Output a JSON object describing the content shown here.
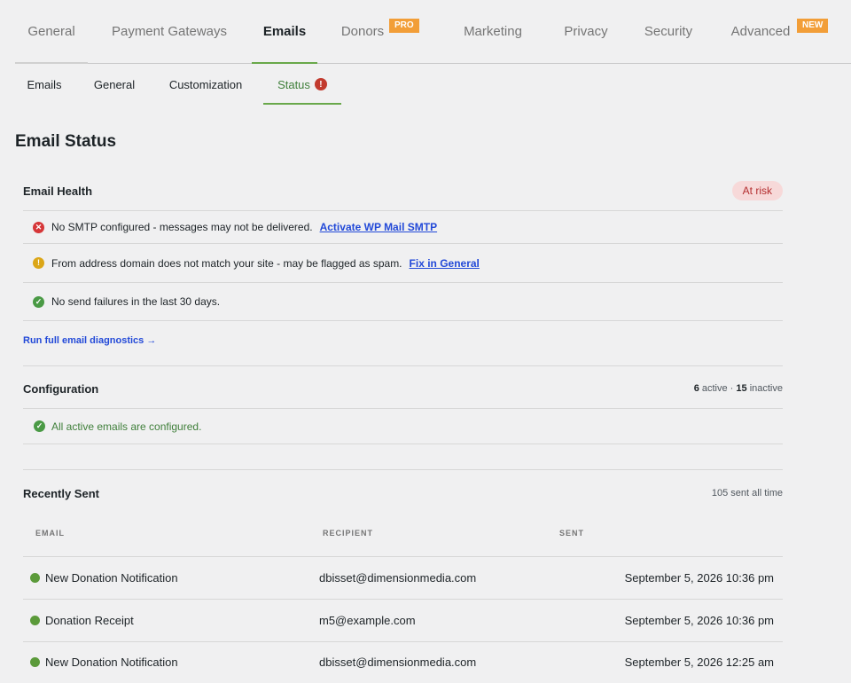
{
  "top_tabs": [
    {
      "label": "General"
    },
    {
      "label": "Payment Gateways"
    },
    {
      "label": "Emails"
    },
    {
      "label": "Donors",
      "badge": "PRO"
    },
    {
      "label": "Marketing"
    },
    {
      "label": "Privacy"
    },
    {
      "label": "Security"
    },
    {
      "label": "Advanced",
      "badge": "NEW"
    }
  ],
  "sub_tabs": [
    {
      "label": "Emails"
    },
    {
      "label": "General"
    },
    {
      "label": "Customization"
    },
    {
      "label": "Status",
      "alert": "!"
    }
  ],
  "page_title": "Email Status",
  "health": {
    "title": "Email Health",
    "status": "At risk",
    "items": [
      {
        "icon": "error-icon",
        "text": "No SMTP configured - messages may not be delivered.",
        "link": "Activate WP Mail SMTP"
      },
      {
        "icon": "warning-icon",
        "text": "From address domain does not match your site - may be flagged as spam.",
        "link": "Fix in General"
      },
      {
        "icon": "check-icon",
        "text": "No send failures in the last 30 days."
      }
    ],
    "diagnostics_link": "Run full email diagnostics →"
  },
  "configuration": {
    "title": "Configuration",
    "active_count": "6",
    "active_label": " active · ",
    "inactive_count": "15",
    "inactive_label": " inactive",
    "ok_text": "All active emails are configured."
  },
  "recent": {
    "title": "Recently Sent",
    "total": "105 sent all time",
    "columns": [
      "EMAIL",
      "RECIPIENT",
      "SENT"
    ],
    "rows": [
      {
        "email": "New Donation Notification",
        "recipient": "dbisset@dimensionmedia.com",
        "sent": "September 5, 2026 10:36 pm"
      },
      {
        "email": "Donation Receipt",
        "recipient": "m5@example.com",
        "sent": "September 5, 2026 10:36 pm"
      },
      {
        "email": "New Donation Notification",
        "recipient": "dbisset@dimensionmedia.com",
        "sent": "September 5, 2026 12:25 am"
      }
    ]
  },
  "colors": {
    "accent": "#69a84a",
    "badge": "#f29e38",
    "error": "#d63638",
    "warning": "#dba617",
    "ok": "#4a9a45",
    "link": "#2249d8"
  }
}
